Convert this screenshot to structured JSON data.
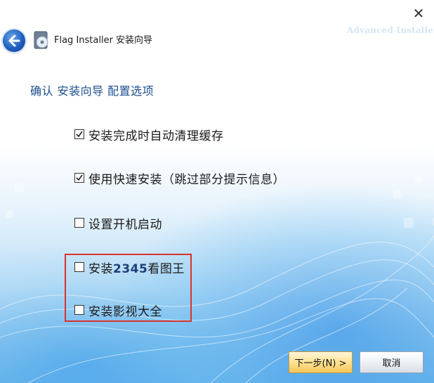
{
  "window": {
    "title": "Flag Installer 安装向导",
    "brand": "Advanced Installer",
    "close_glyph": "✕"
  },
  "heading": "确认 安装向导 配置选项",
  "options": [
    {
      "label": "安装完成时自动清理缓存",
      "checked": true
    },
    {
      "label": "使用快速安装（跳过部分提示信息）",
      "checked": true
    },
    {
      "label": "设置开机启动",
      "checked": false
    },
    {
      "label_prefix": "安装",
      "label_bold": "2345",
      "label_suffix": "看图王",
      "checked": false
    },
    {
      "label": "安装影视大全",
      "checked": false
    }
  ],
  "buttons": {
    "next": "下一步(N) >",
    "cancel": "取消"
  },
  "colors": {
    "heading": "#1c4f8f",
    "highlight_border": "#d9322e",
    "back_button": "#1f5fbf"
  },
  "icons": [
    "back-arrow-icon",
    "installer-disc-icon",
    "close-icon",
    "checkbox-checked-icon",
    "checkbox-unchecked-icon"
  ]
}
